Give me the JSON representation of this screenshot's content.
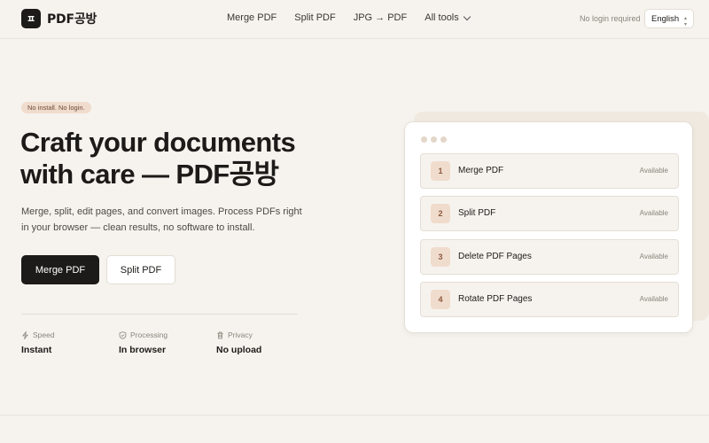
{
  "header": {
    "logo_mark": "ㅍ",
    "brand": "PDF공방",
    "nav": [
      "Merge PDF",
      "Split PDF",
      "JPG → PDF",
      "All tools"
    ],
    "no_login": "No login required",
    "language": "English"
  },
  "hero": {
    "badge": "No install. No login.",
    "title_line1": "Craft your documents",
    "title_line2": "with care — PDF공방",
    "description": "Merge, split, edit pages, and convert images. Process PDFs right in your browser — clean results, no software to install.",
    "primary_button": "Merge PDF",
    "secondary_button": "Split PDF",
    "stats": [
      {
        "icon": "bolt-icon",
        "label": "Speed",
        "value": "Instant"
      },
      {
        "icon": "shield-icon",
        "label": "Processing",
        "value": "In browser"
      },
      {
        "icon": "trash-icon",
        "label": "Privacy",
        "value": "No upload"
      }
    ]
  },
  "card": {
    "items": [
      {
        "num": "1",
        "name": "Merge PDF",
        "status": "Available"
      },
      {
        "num": "2",
        "name": "Split PDF",
        "status": "Available"
      },
      {
        "num": "3",
        "name": "Delete PDF Pages",
        "status": "Available"
      },
      {
        "num": "4",
        "name": "Rotate PDF Pages",
        "status": "Available"
      }
    ]
  },
  "colors": {
    "background": "#f6f3ee",
    "primary": "#1d1b19",
    "accent": "#f0dccd"
  }
}
